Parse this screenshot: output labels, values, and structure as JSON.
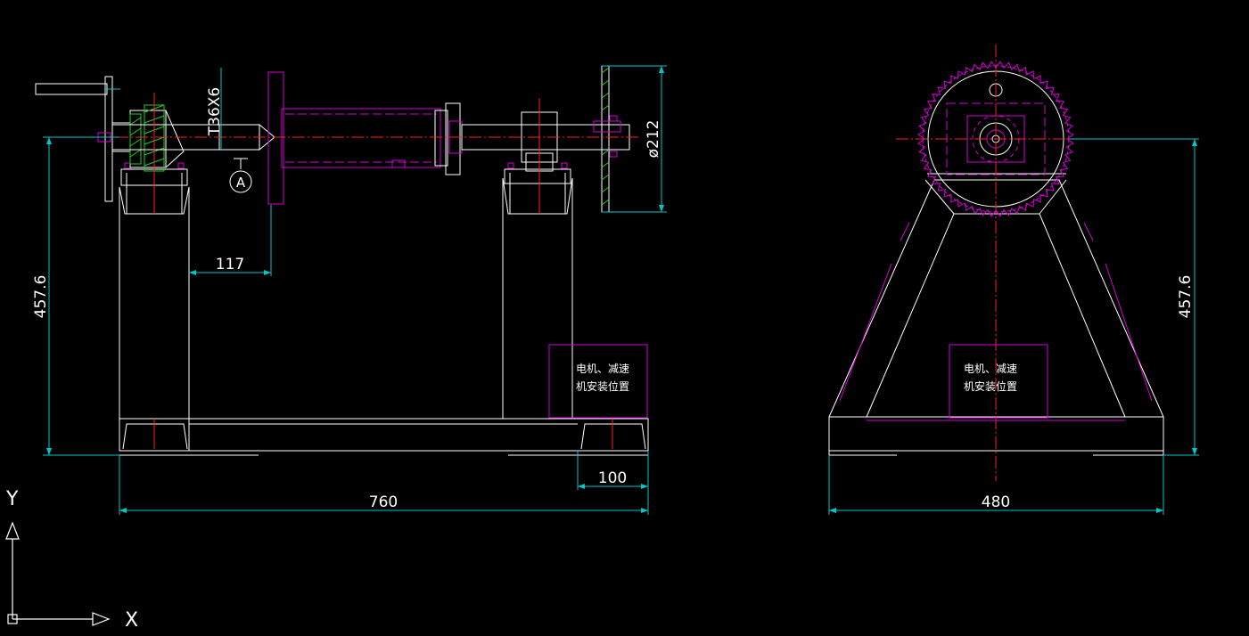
{
  "colors": {
    "background": "#000000",
    "outline": "#ffffff",
    "dimension": "#00c8c8",
    "centerline": "#ff2020",
    "hidden": "#d400d4",
    "hatch": "#20d020"
  },
  "dimensions": {
    "thread": "T36X6",
    "section_marker": "A",
    "length_117": "117",
    "height_left": "457.6",
    "diameter": "ø212",
    "offset_100": "100",
    "length_760": "760",
    "width_480": "480",
    "height_right": "457.6"
  },
  "notes": {
    "motor_front_line1": "电机、减速",
    "motor_front_line2": "机安装位置",
    "motor_side_line1": "电机、减速",
    "motor_side_line2": "机安装位置"
  },
  "ucs": {
    "x_label": "X",
    "y_label": "Y"
  }
}
